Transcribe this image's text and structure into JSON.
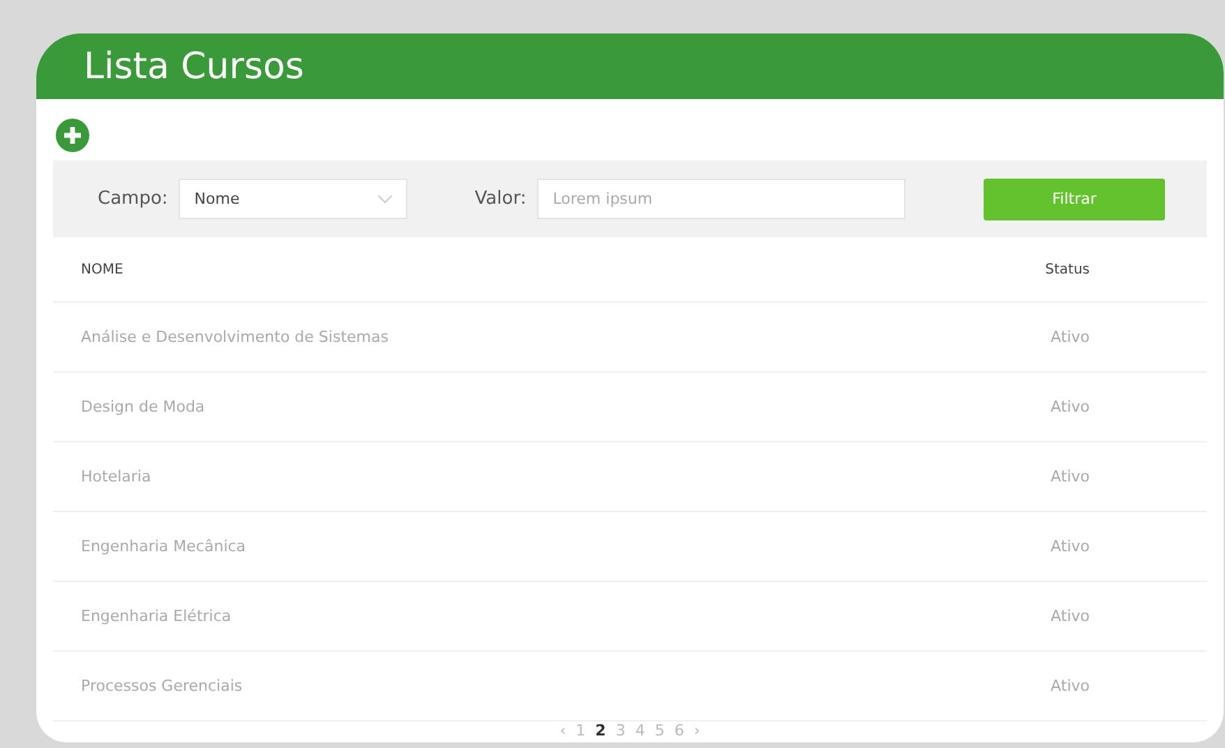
{
  "title": "Lista Cursos",
  "filter": {
    "field_label": "Campo:",
    "field_value": "Nome",
    "value_label": "Valor:",
    "value_placeholder": "Lorem ipsum",
    "button": "Filtrar"
  },
  "table": {
    "columns": [
      "NOME",
      "Status"
    ],
    "rows": [
      [
        "Análise e Desenvolvimento de Sistemas",
        "Ativo"
      ],
      [
        "Design de Moda",
        "Ativo"
      ],
      [
        "Hotelaria",
        "Ativo"
      ],
      [
        "Engenharia Mecânica",
        "Ativo"
      ],
      [
        "Engenharia Elétrica",
        "Ativo"
      ],
      [
        "Processos Gerenciais",
        "Ativo"
      ]
    ]
  },
  "pagination": {
    "prev": "‹",
    "next": "›",
    "pages": [
      {
        "label": "1",
        "selected": false
      },
      {
        "label": "2",
        "selected": true
      },
      {
        "label": "3",
        "selected": false
      },
      {
        "label": "4",
        "selected": false
      },
      {
        "label": "5",
        "selected": false
      },
      {
        "label": "6",
        "selected": false
      }
    ]
  }
}
